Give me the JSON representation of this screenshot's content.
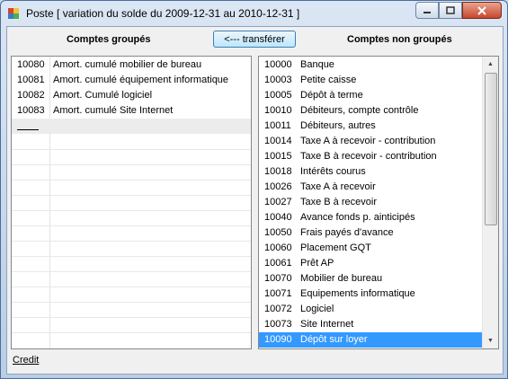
{
  "window": {
    "title": "Poste  [ variation du solde du 2009-12-31 au 2010-12-31 ]",
    "icon": "app-icon"
  },
  "left": {
    "header": "Comptes groupés",
    "rows": [
      {
        "code": "10080",
        "name": "Amort. cumulé mobilier de bureau"
      },
      {
        "code": "10081",
        "name": "Amort. cumulé équipement informatique"
      },
      {
        "code": "10082",
        "name": "Amort. Cumulé logiciel"
      },
      {
        "code": "10083",
        "name": "Amort. cumulé Site Internet"
      }
    ]
  },
  "transfer_label": "<--- transférer",
  "right": {
    "header": "Comptes non groupés",
    "rows": [
      {
        "code": "10000",
        "name": "Banque"
      },
      {
        "code": "10003",
        "name": "Petite caisse"
      },
      {
        "code": "10005",
        "name": "Dépôt à terme"
      },
      {
        "code": "10010",
        "name": "Débiteurs, compte contrôle"
      },
      {
        "code": "10011",
        "name": "Débiteurs, autres"
      },
      {
        "code": "10014",
        "name": "Taxe A à recevoir - contribution"
      },
      {
        "code": "10015",
        "name": "Taxe B à recevoir - contribution"
      },
      {
        "code": "10018",
        "name": "Intérêts courus"
      },
      {
        "code": "10026",
        "name": "Taxe A à recevoir"
      },
      {
        "code": "10027",
        "name": "Taxe B à recevoir"
      },
      {
        "code": "10040",
        "name": "Avance fonds p. ainticipés"
      },
      {
        "code": "10050",
        "name": "Frais payés d'avance"
      },
      {
        "code": "10060",
        "name": "Placement GQT"
      },
      {
        "code": "10061",
        "name": "Prêt AP"
      },
      {
        "code": "10070",
        "name": "Mobilier de bureau"
      },
      {
        "code": "10071",
        "name": "Equipements informatique"
      },
      {
        "code": "10072",
        "name": "Logiciel"
      },
      {
        "code": "10073",
        "name": "Site Internet"
      },
      {
        "code": "10090",
        "name": "Dépôt sur loyer"
      }
    ],
    "selected_index": 18
  },
  "credit_link": "Credit",
  "colors": {
    "selection": "#3399ff",
    "title_close": "#c8462b"
  }
}
